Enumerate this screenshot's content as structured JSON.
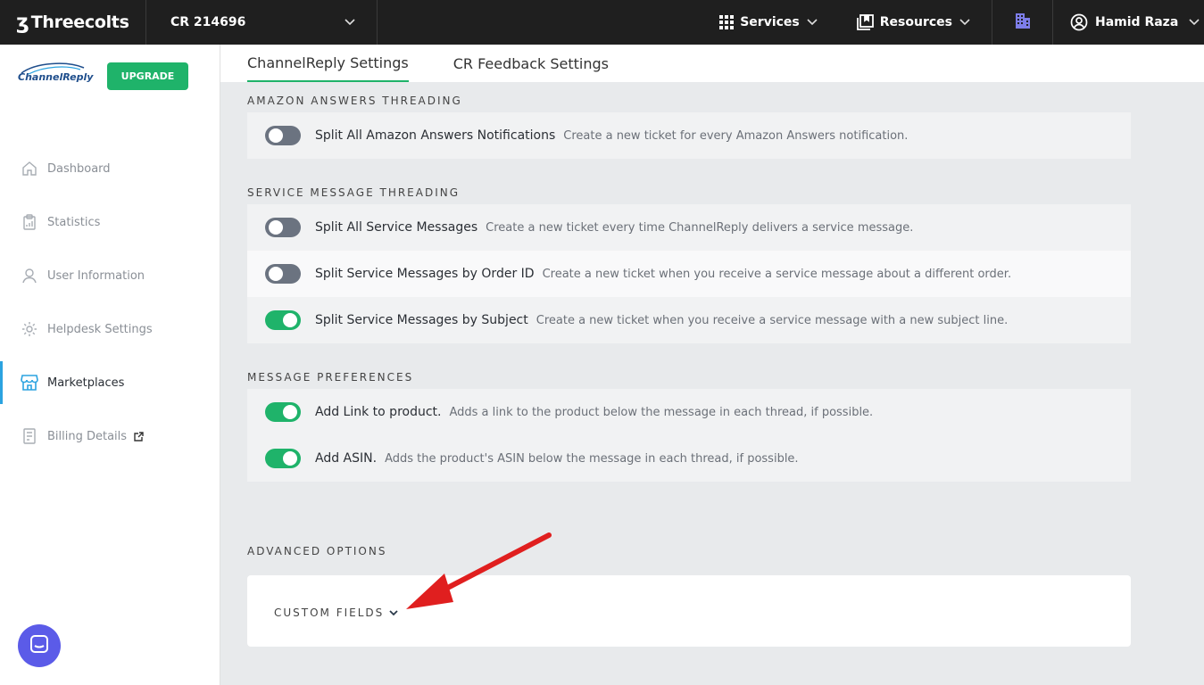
{
  "topbar": {
    "brand": "Threecolts",
    "account": "CR 214696",
    "services": "Services",
    "resources": "Resources",
    "user": "Hamid Raza"
  },
  "sidebar": {
    "logo": "ChannelReply",
    "upgrade": "UPGRADE",
    "items": [
      {
        "label": "Dashboard",
        "icon": "home-icon"
      },
      {
        "label": "Statistics",
        "icon": "clipboard-icon"
      },
      {
        "label": "User Information",
        "icon": "user-icon"
      },
      {
        "label": "Helpdesk Settings",
        "icon": "gear-icon"
      },
      {
        "label": "Marketplaces",
        "icon": "store-icon"
      },
      {
        "label": "Billing Details",
        "icon": "billing-icon"
      }
    ]
  },
  "tabs": [
    "ChannelReply Settings",
    "CR Feedback Settings"
  ],
  "sections": {
    "amazon": {
      "title": "AMAZON ANSWERS THREADING",
      "rows": [
        {
          "title": "Split All Amazon Answers Notifications",
          "desc": "Create a new ticket for every Amazon Answers notification.",
          "on": false
        }
      ]
    },
    "service": {
      "title": "SERVICE MESSAGE THREADING",
      "rows": [
        {
          "title": "Split All Service Messages",
          "desc": "Create a new ticket every time ChannelReply delivers a service message.",
          "on": false
        },
        {
          "title": "Split Service Messages by Order ID",
          "desc": "Create a new ticket when you receive a service message about a different order.",
          "on": false
        },
        {
          "title": "Split Service Messages by Subject",
          "desc": "Create a new ticket when you receive a service message with a new subject line.",
          "on": true
        }
      ]
    },
    "prefs": {
      "title": "MESSAGE PREFERENCES",
      "rows": [
        {
          "title": "Add Link to product.",
          "desc": "Adds a link to the product below the message in each thread, if possible.",
          "on": true
        },
        {
          "title": "Add ASIN.",
          "desc": "Adds the product's ASIN below the message in each thread, if possible.",
          "on": true
        }
      ]
    },
    "advanced": {
      "title": "ADVANCED OPTIONS",
      "custom_fields": "CUSTOM FIELDS"
    }
  },
  "colors": {
    "accent": "#1fb36a",
    "active_nav": "#2ba3e0",
    "chat": "#5b5be8",
    "arrow": "#e01f1f"
  }
}
